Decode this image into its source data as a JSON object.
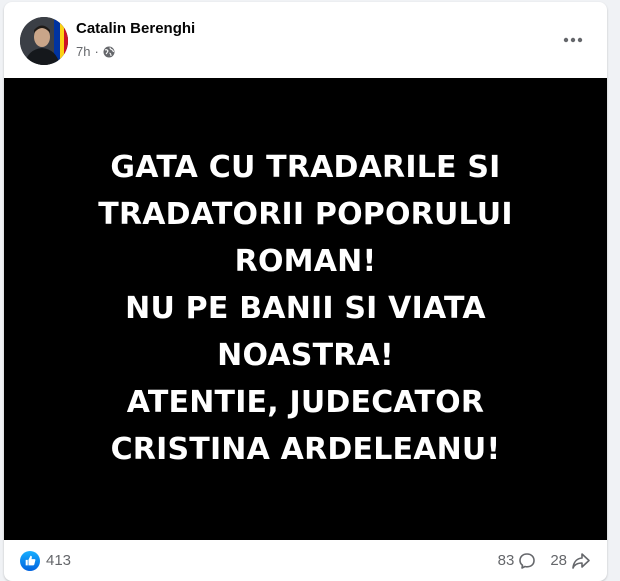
{
  "post": {
    "author": "Catalin Berenghi",
    "time": "7h",
    "separator": "·",
    "audience_icon": "globe-icon",
    "more_icon": "more-horizontal-icon",
    "image_text_lines": [
      "GATA CU TRADARILE SI",
      "TRADATORII POPORULUI",
      "ROMAN!",
      "NU PE BANII SI VIATA",
      "NOASTRA!",
      "ATENTIE, JUDECATOR",
      "CRISTINA ARDELEANU!"
    ]
  },
  "footer": {
    "reaction_icon": "like-icon",
    "reactions_count": "413",
    "comments_count": "83",
    "comment_icon": "comment-icon",
    "shares_count": "28",
    "share_icon": "share-icon"
  },
  "colors": {
    "like_blue": "#0866ff",
    "text_secondary": "#65676b",
    "image_background": "#000000"
  }
}
